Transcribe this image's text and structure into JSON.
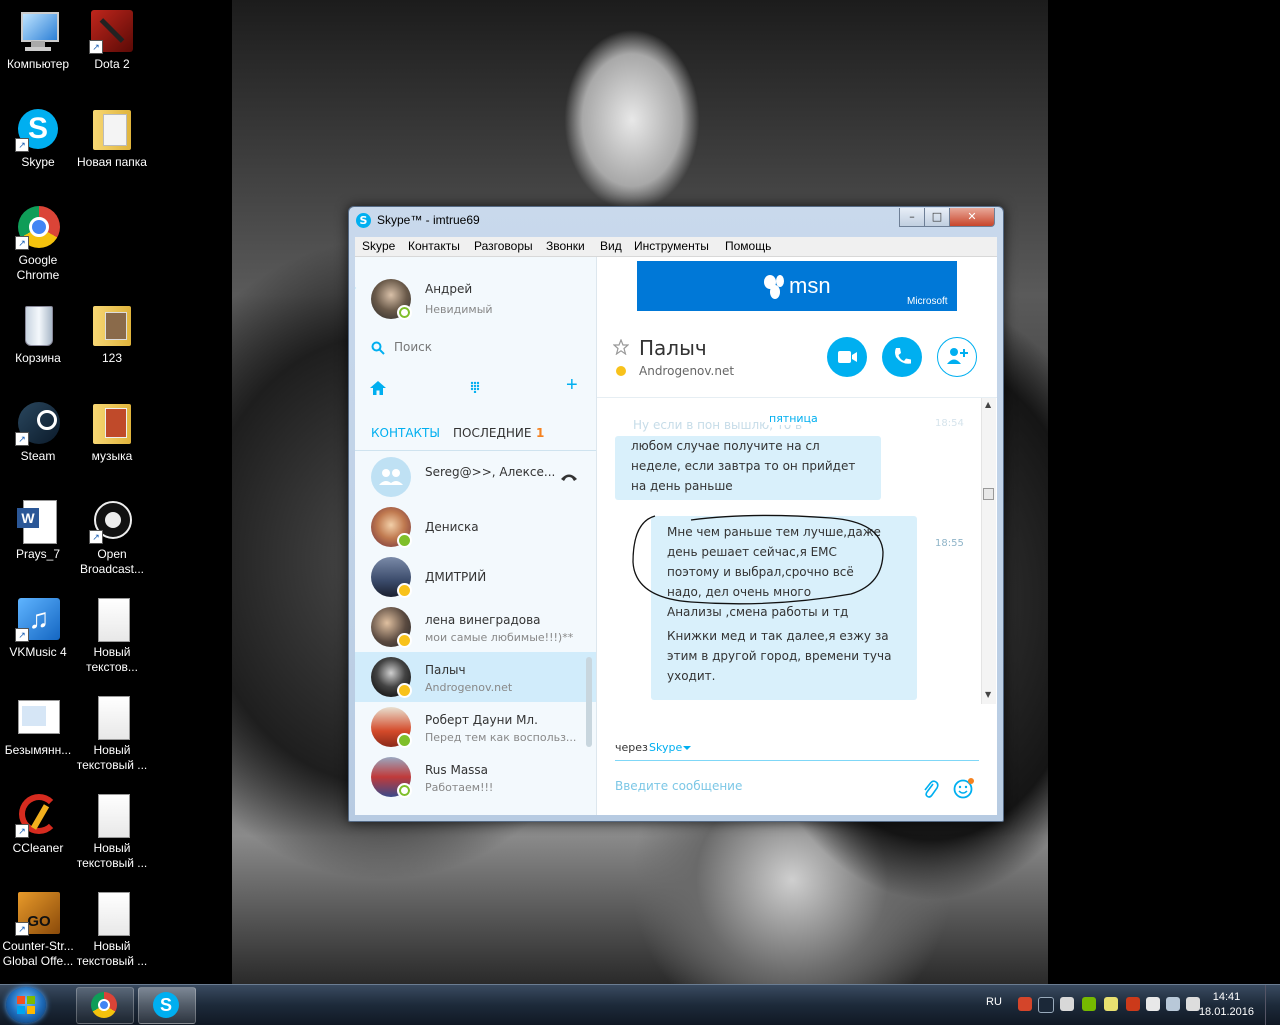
{
  "desktop": {
    "icons": [
      {
        "label": "Компьютер",
        "icon": "computer-icon"
      },
      {
        "label": "Dota 2",
        "icon": "dota2-icon"
      },
      {
        "label": "Skype",
        "icon": "skype-icon"
      },
      {
        "label": "Новая папка",
        "icon": "folder-icon"
      },
      {
        "label": "Google Chrome",
        "icon": "chrome-icon"
      },
      {
        "label": "Корзина",
        "icon": "recycle-bin-icon"
      },
      {
        "label": "123",
        "icon": "folder-icon"
      },
      {
        "label": "Steam",
        "icon": "steam-icon"
      },
      {
        "label": "музыка",
        "icon": "folder-icon"
      },
      {
        "label": "Prays_7",
        "icon": "word-document-icon"
      },
      {
        "label": "Open Broadcast...",
        "icon": "obs-icon"
      },
      {
        "label": "VKMusic 4",
        "icon": "vkmusic-icon"
      },
      {
        "label": "Новый текстов...",
        "icon": "text-file-icon"
      },
      {
        "label": "Безымянн...",
        "icon": "image-file-icon"
      },
      {
        "label": "Новый текстовый ...",
        "icon": "text-file-icon"
      },
      {
        "label": "CCleaner",
        "icon": "ccleaner-icon"
      },
      {
        "label": "Новый текстовый ...",
        "icon": "text-file-icon"
      },
      {
        "label": "Counter-Str... Global Offe...",
        "icon": "csgo-icon"
      },
      {
        "label": "Новый текстовый ...",
        "icon": "text-file-icon"
      }
    ]
  },
  "taskbar": {
    "lang": "RU",
    "time": "14:41",
    "date": "18.01.2016"
  },
  "skype": {
    "title": "Skype™ - imtrue69",
    "menu": [
      "Skype",
      "Контакты",
      "Разговоры",
      "Звонки",
      "Вид",
      "Инструменты",
      "Помощь"
    ],
    "profile": {
      "name": "Андрей",
      "status": "Невидимый"
    },
    "search_placeholder": "Поиск",
    "tabs": {
      "contacts": "КОНТАКТЫ",
      "recent": "ПОСЛЕДНИЕ",
      "recent_count": "1"
    },
    "contacts": [
      {
        "name": "Sereg@>>, Алексе...",
        "mood": "",
        "status": "group"
      },
      {
        "name": "Дениска",
        "mood": "",
        "status": "online"
      },
      {
        "name": "ДМИТРИЙ",
        "mood": "",
        "status": "away"
      },
      {
        "name": "лена винеградова",
        "mood": "мои самые любимые!!!)**",
        "status": "away"
      },
      {
        "name": "Палыч",
        "mood": "Androgenov.net",
        "status": "away"
      },
      {
        "name": "Роберт Дауни Мл.",
        "mood": "Перед тем как воспольз...",
        "status": "online"
      },
      {
        "name": "Rus Massa",
        "mood": "Работаем!!!",
        "status": "inv"
      }
    ],
    "banner": {
      "brand": "msn",
      "maker": "Microsoft"
    },
    "chat": {
      "contact_name": "Палыч",
      "contact_mood": "Androgenov.net",
      "day_label": "пятница",
      "faded_line": "Ну если в пон вышлю, то в",
      "faded_time": "18:54",
      "incoming": [
        "любом случае получите на сл",
        "неделе, если завтра то он прийдет",
        "на день раньше"
      ],
      "outgoing_time": "18:55",
      "outgoing": [
        "Мне чем раньше тем лучше,даже",
        "день решает сейчас,я ЕМС",
        "поэтому и выбрал,срочно всё",
        "надо, дел очень много",
        "Анализы ,смена работы и тд",
        "Книжки мед и так далее,я езжу за",
        "этим в другой город, времени туча",
        "уходит."
      ],
      "via_label": "через",
      "via_service": "Skype",
      "input_placeholder": "Введите сообщение"
    },
    "colors": {
      "accent": "#00aff0",
      "selected": "#d1ecfb",
      "bubble": "#d9f0fb"
    }
  }
}
